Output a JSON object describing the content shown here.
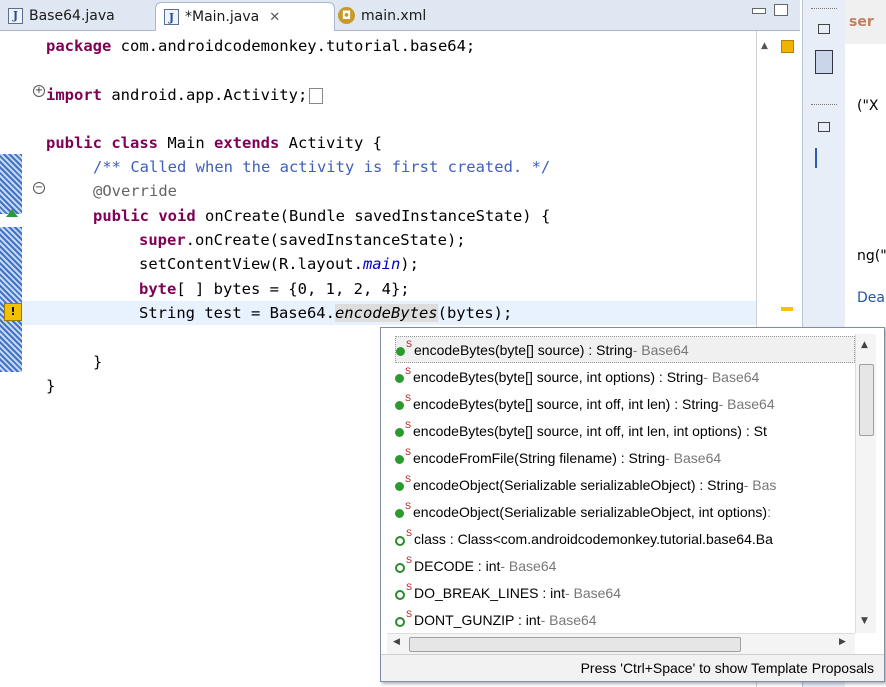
{
  "tabs": [
    {
      "label": "Base64.java",
      "icon": "java-file-icon"
    },
    {
      "label": "*Main.java",
      "icon": "java-file-icon",
      "close": "✕"
    },
    {
      "label": "main.xml",
      "icon": "xml-file-icon"
    }
  ],
  "editor": {
    "lines": {
      "l1_kw": "package",
      "l1_rest": " com.androidcodemonkey.tutorial.base64;",
      "l2_kw": "import",
      "l2_rest": " android.app.Activity;",
      "l3_kw1": "public",
      "l3_kw2": "class",
      "l3_mid": " Main ",
      "l3_kw3": "extends",
      "l3_rest": " Activity {",
      "l4_doc": "/** Called when the activity is first created. */",
      "l5_ann": "@Override",
      "l6_kw1": "public",
      "l6_kw2": "void",
      "l6_rest": " onCreate(Bundle savedInstanceState) {",
      "l7_kw": "super",
      "l7_rest": ".onCreate(savedInstanceState);",
      "l8_a": "setContentView(R.layout.",
      "l8_it": "main",
      "l8_b": ");",
      "l9_kw": "byte",
      "l9_rest": "[ ] bytes = {0, 1, 2, 4};",
      "l10_a": "String test = Base64.",
      "l10_it": "encodeBytes",
      "l10_b": "(bytes);",
      "l11": "}",
      "l12": "}"
    }
  },
  "right_pane": {
    "text1": "ser",
    "text2": "(\"X",
    "text3": "ng(\"",
    "text4": "Dea"
  },
  "completion": {
    "items": [
      {
        "name": "encodeBytes(byte[] source) : String",
        "owner": " - Base64",
        "kind": "static-method"
      },
      {
        "name": "encodeBytes(byte[] source, int options) : String",
        "owner": " - Base64",
        "kind": "static-method"
      },
      {
        "name": "encodeBytes(byte[] source, int off, int len) : String",
        "owner": " - Base64",
        "kind": "static-method"
      },
      {
        "name": "encodeBytes(byte[] source, int off, int len, int options) : St",
        "owner": "",
        "kind": "static-method"
      },
      {
        "name": "encodeFromFile(String filename) : String",
        "owner": " - Base64",
        "kind": "static-method"
      },
      {
        "name": "encodeObject(Serializable serializableObject) : String",
        "owner": " - Bas",
        "kind": "static-method"
      },
      {
        "name": "encodeObject(Serializable serializableObject, int options)",
        "owner": " :",
        "kind": "static-method"
      },
      {
        "name": "class : Class<com.androidcodemonkey.tutorial.base64.Ba",
        "owner": "",
        "kind": "static-field"
      },
      {
        "name": "DECODE : int",
        "owner": " - Base64",
        "kind": "static-field"
      },
      {
        "name": "DO_BREAK_LINES : int",
        "owner": " - Base64",
        "kind": "static-field"
      },
      {
        "name": "DONT_GUNZIP : int",
        "owner": " - Base64",
        "kind": "static-field"
      }
    ],
    "footer": "Press 'Ctrl+Space' to show Template Proposals"
  },
  "colors": {
    "keyword": "#7f0055",
    "javadoc": "#3f5fbf",
    "annotation": "#646464",
    "field": "#0000c0",
    "selection": "#f0f0f0"
  }
}
